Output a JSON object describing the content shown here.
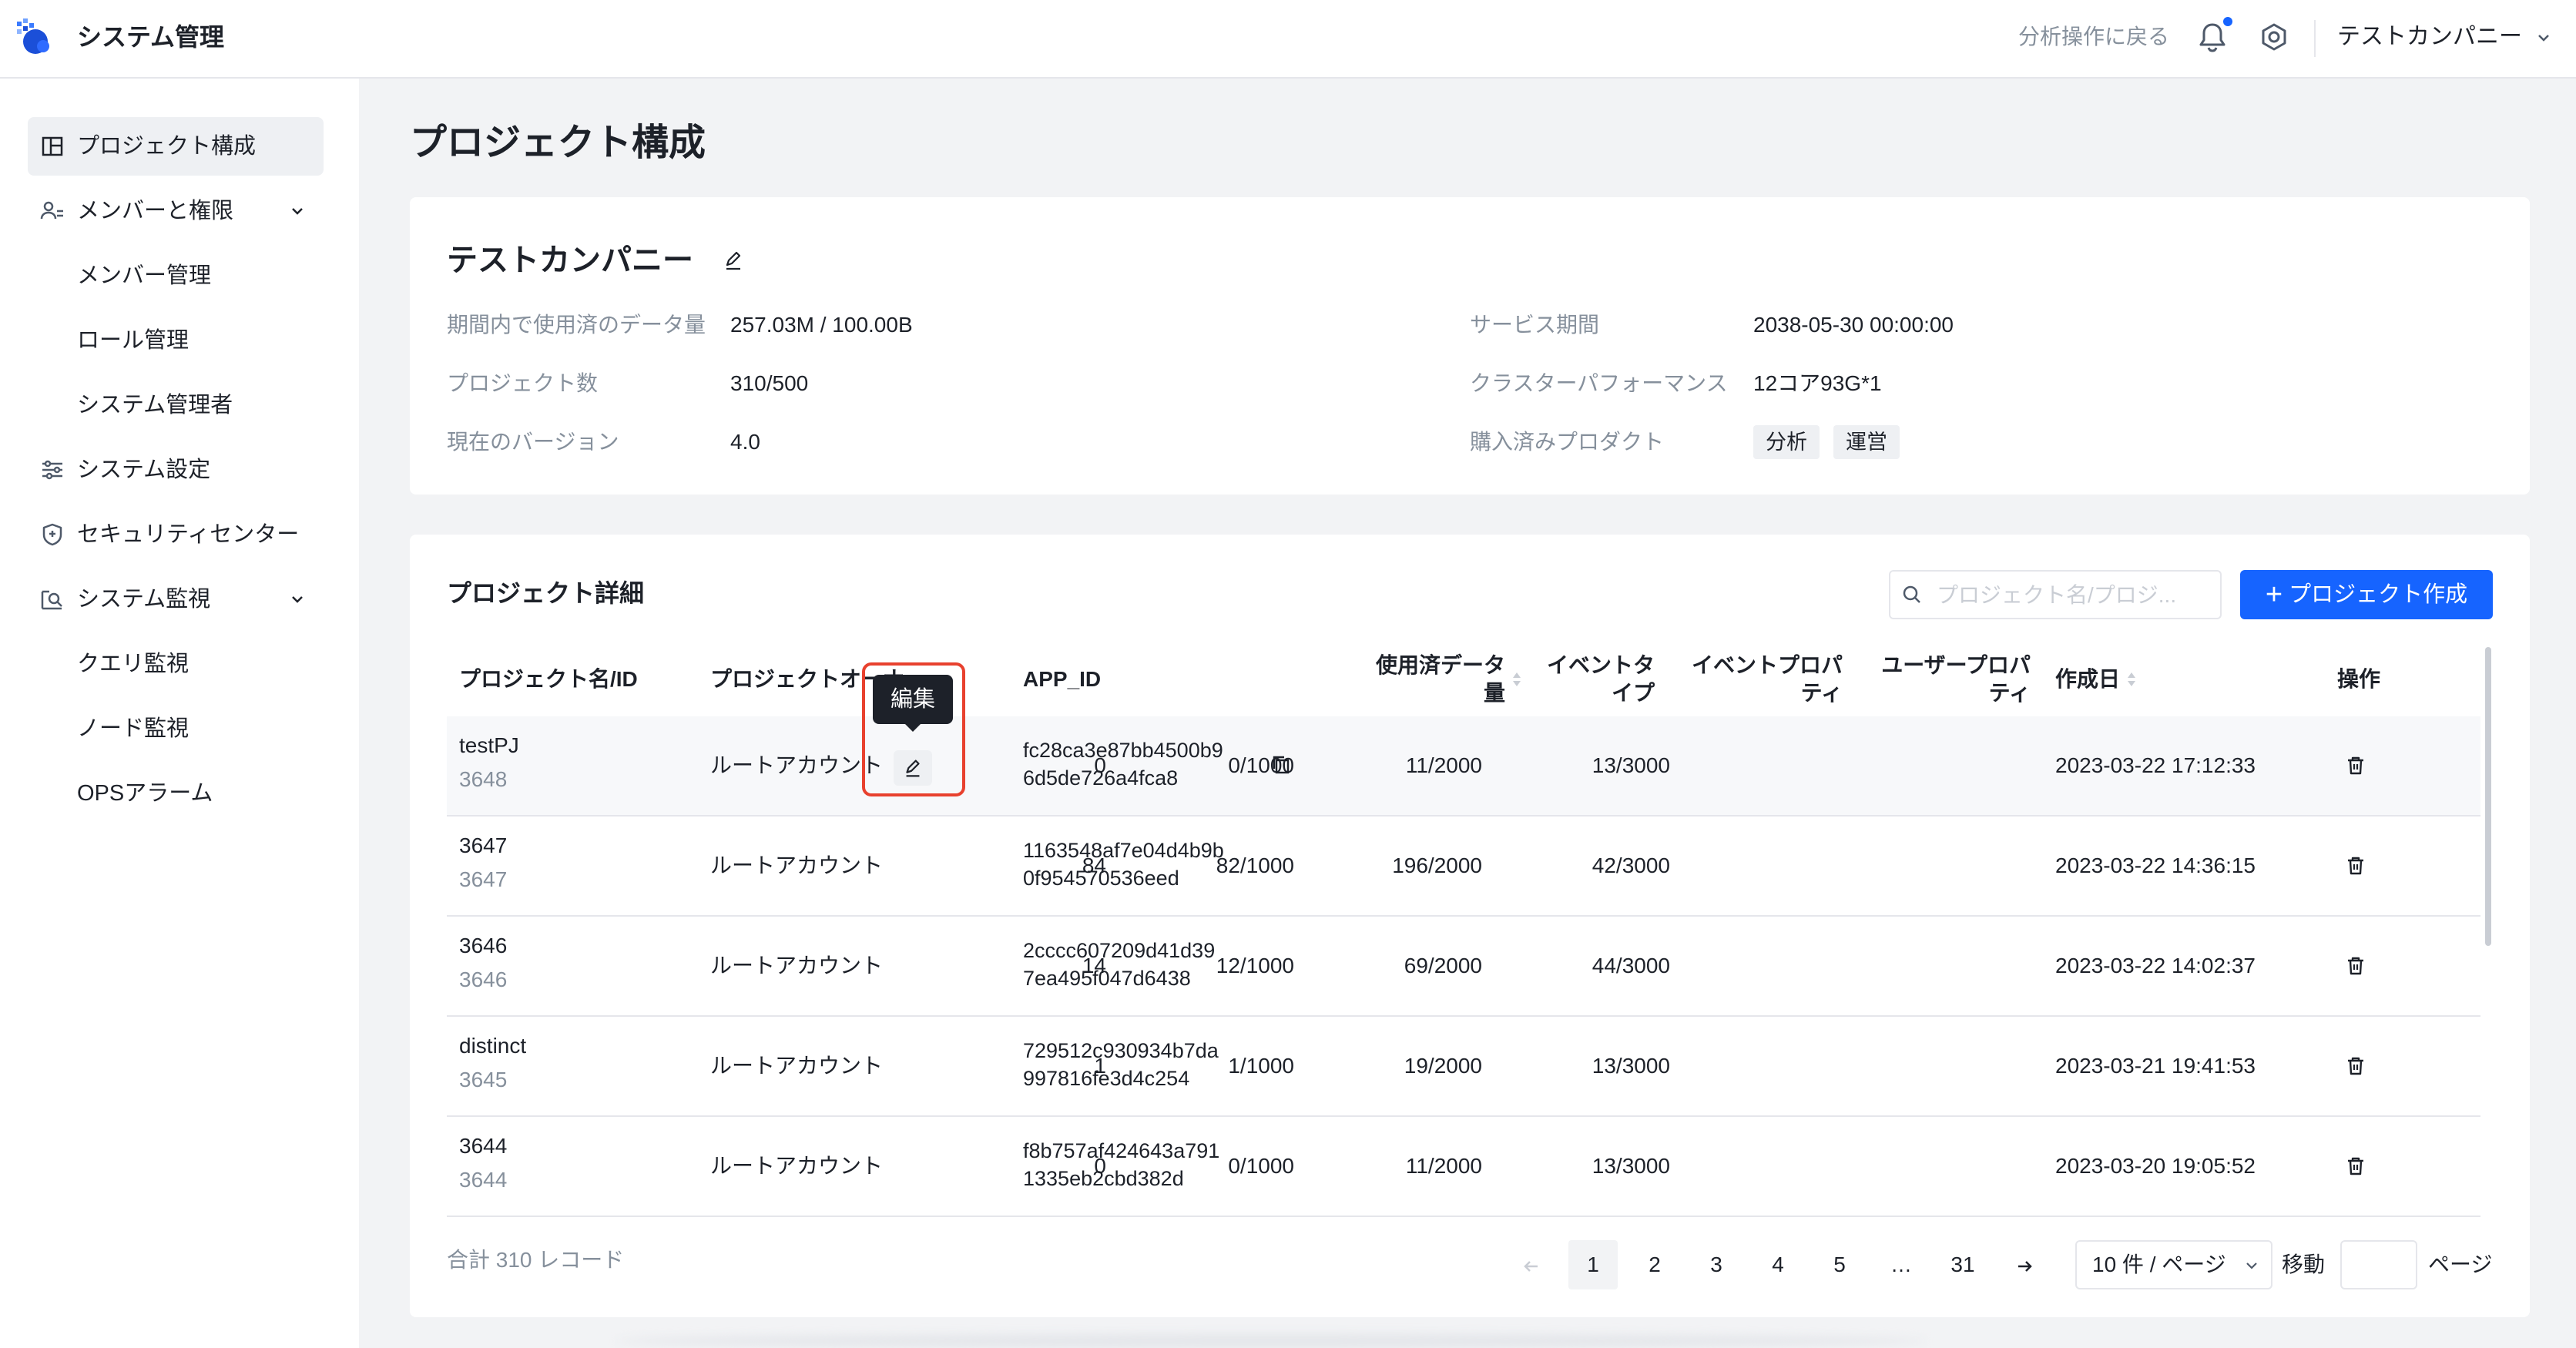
{
  "header": {
    "app_title": "システム管理",
    "back_link": "分析操作に戻る",
    "company": "テストカンパニー"
  },
  "sidebar": {
    "items": [
      {
        "label": "プロジェクト構成",
        "icon": "project-layout-icon",
        "active": true
      },
      {
        "label": "メンバーと権限",
        "icon": "members-icon",
        "expandable": true
      },
      {
        "label": "メンバー管理",
        "sub": true
      },
      {
        "label": "ロール管理",
        "sub": true
      },
      {
        "label": "システム管理者",
        "sub": true
      },
      {
        "label": "システム設定",
        "icon": "sliders-icon"
      },
      {
        "label": "セキュリティセンター",
        "icon": "shield-icon"
      },
      {
        "label": "システム監視",
        "icon": "monitor-search-icon",
        "expandable": true
      },
      {
        "label": "クエリ監視",
        "sub": true
      },
      {
        "label": "ノード監視",
        "sub": true
      },
      {
        "label": "OPSアラーム",
        "sub": true
      }
    ]
  },
  "page_title": "プロジェクト構成",
  "company_card": {
    "name": "テストカンパニー",
    "left": [
      {
        "label": "期間内で使用済のデータ量",
        "value": "257.03M / 100.00B"
      },
      {
        "label": "プロジェクト数",
        "value": "310/500"
      },
      {
        "label": "現在のバージョン",
        "value": "4.0"
      }
    ],
    "right": [
      {
        "label": "サービス期間",
        "value": "2038-05-30 00:00:00"
      },
      {
        "label": "クラスターパフォーマンス",
        "value": "12コア93G*1"
      },
      {
        "label": "購入済みプロダクト",
        "tags": [
          "分析",
          "運営"
        ]
      }
    ]
  },
  "details": {
    "title": "プロジェクト詳細",
    "search_placeholder": "プロジェクト名/プロジ...",
    "create_button": "プロジェクト作成",
    "columns": {
      "name": "プロジェクト名/ID",
      "owner": "プロジェクトオーナー",
      "app_id": "APP_ID",
      "data_l1": "使用済データ",
      "data_l2": "量",
      "event_type": "イベントタイプ",
      "event_prop_l1": "イベントプロパ",
      "event_prop_l2": "ティ",
      "user_prop_l1": "ユーザープロパ",
      "user_prop_l2": "ティ",
      "created": "作成日",
      "actions": "操作"
    },
    "tooltip": "編集",
    "rows": [
      {
        "name": "testPJ",
        "id": "3648",
        "owner": "ルートアカウント",
        "app_id_1": "fc28ca3e87bb4500b9",
        "app_id_2": "6d5de726a4fca8",
        "data": "0",
        "event_type": "0/1000",
        "event_prop": "11/2000",
        "user_prop": "13/3000",
        "created": "2023-03-22 17:12:33"
      },
      {
        "name": "3647",
        "id": "3647",
        "owner": "ルートアカウント",
        "app_id_1": "1163548af7e04d4b9b",
        "app_id_2": "0f954570536eed",
        "data": "84",
        "event_type": "82/1000",
        "event_prop": "196/2000",
        "user_prop": "42/3000",
        "created": "2023-03-22 14:36:15"
      },
      {
        "name": "3646",
        "id": "3646",
        "owner": "ルートアカウント",
        "app_id_1": "2cccc607209d41d39",
        "app_id_2": "7ea495f047d6438",
        "data": "14",
        "event_type": "12/1000",
        "event_prop": "69/2000",
        "user_prop": "44/3000",
        "created": "2023-03-22 14:02:37"
      },
      {
        "name": "distinct",
        "id": "3645",
        "owner": "ルートアカウント",
        "app_id_1": "729512c930934b7da",
        "app_id_2": "997816fe3d4c254",
        "data": "1",
        "event_type": "1/1000",
        "event_prop": "19/2000",
        "user_prop": "13/3000",
        "created": "2023-03-21 19:41:53"
      },
      {
        "name": "3644",
        "id": "3644",
        "owner": "ルートアカウント",
        "app_id_1": "f8b757af424643a791",
        "app_id_2": "1335eb2cbd382d",
        "data": "0",
        "event_type": "0/1000",
        "event_prop": "11/2000",
        "user_prop": "13/3000",
        "created": "2023-03-20 19:05:52"
      }
    ]
  },
  "pagination": {
    "total": "合計 310 レコード",
    "pages": [
      "1",
      "2",
      "3",
      "4",
      "5",
      "…",
      "31"
    ],
    "current": "1",
    "page_size": "10 件 / ページ",
    "goto_label": "移動",
    "page_label": "ページ"
  }
}
